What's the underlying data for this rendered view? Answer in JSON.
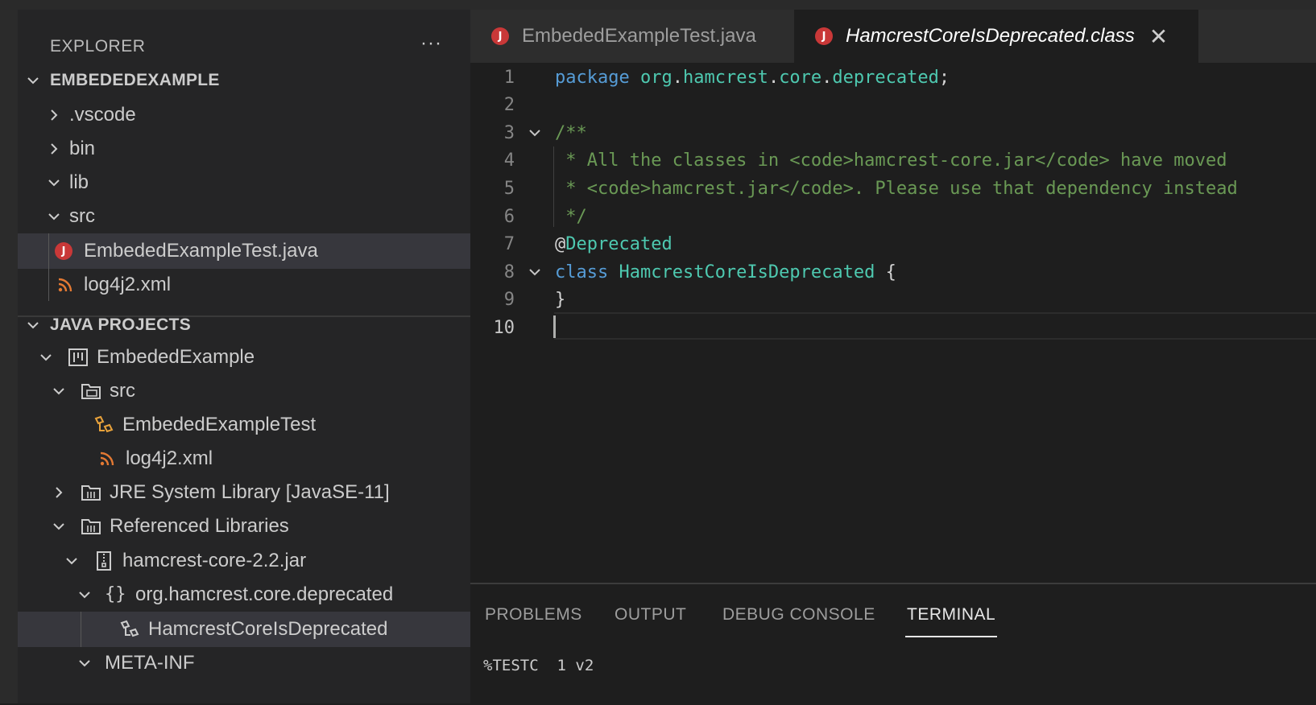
{
  "explorer": {
    "title": "EXPLORER",
    "more": "···",
    "workspace": "EMBEDEDEXAMPLE",
    "items": [
      {
        "label": ".vscode"
      },
      {
        "label": "bin"
      },
      {
        "label": "lib"
      },
      {
        "label": "src"
      },
      {
        "label": "EmbededExampleTest.java"
      },
      {
        "label": "log4j2.xml"
      }
    ]
  },
  "java_projects": {
    "header": "JAVA PROJECTS",
    "items": [
      {
        "label": "EmbededExample"
      },
      {
        "label": "src"
      },
      {
        "label": "EmbededExampleTest"
      },
      {
        "label": "log4j2.xml"
      },
      {
        "label": "JRE System Library [JavaSE-11]"
      },
      {
        "label": "Referenced Libraries"
      },
      {
        "label": "hamcrest-core-2.2.jar"
      },
      {
        "label": "org.hamcrest.core.deprecated"
      },
      {
        "label": "HamcrestCoreIsDeprecated"
      },
      {
        "label": "META-INF"
      }
    ]
  },
  "tabs": [
    {
      "label": "EmbededExampleTest.java",
      "icon": "J"
    },
    {
      "label": "HamcrestCoreIsDeprecated.class",
      "icon": "J",
      "close": "✕"
    }
  ],
  "editor": {
    "lines": [
      {
        "n": "1",
        "t": [
          [
            "kw",
            "package"
          ],
          [
            "code",
            " "
          ],
          [
            "ty",
            "org"
          ],
          [
            "code",
            "."
          ],
          [
            "ty",
            "hamcrest"
          ],
          [
            "code",
            "."
          ],
          [
            "ty",
            "core"
          ],
          [
            "code",
            "."
          ],
          [
            "ty",
            "deprecated"
          ],
          [
            "code",
            ";"
          ]
        ]
      },
      {
        "n": "2",
        "t": []
      },
      {
        "n": "3",
        "t": [
          [
            "cm",
            "/**"
          ]
        ]
      },
      {
        "n": "4",
        "t": [
          [
            "cm",
            " * All the classes in <code>hamcrest-core.jar</code> have moved"
          ]
        ]
      },
      {
        "n": "5",
        "t": [
          [
            "cm",
            " * <code>hamcrest.jar</code>. Please use that dependency instead"
          ]
        ]
      },
      {
        "n": "6",
        "t": [
          [
            "cm",
            " */"
          ]
        ]
      },
      {
        "n": "7",
        "t": [
          [
            "code",
            "@"
          ],
          [
            "ann",
            "Deprecated"
          ]
        ]
      },
      {
        "n": "8",
        "t": [
          [
            "kw",
            "class"
          ],
          [
            "code",
            " "
          ],
          [
            "ty",
            "HamcrestCoreIsDeprecated"
          ],
          [
            "code",
            " {"
          ]
        ]
      },
      {
        "n": "9",
        "t": [
          [
            "code",
            "}"
          ]
        ]
      },
      {
        "n": "10",
        "t": []
      }
    ]
  },
  "panel": {
    "tabs": [
      "PROBLEMS",
      "OUTPUT",
      "DEBUG CONSOLE",
      "TERMINAL"
    ],
    "active": "TERMINAL",
    "terminal_line": "%TESTC  1 v2"
  }
}
